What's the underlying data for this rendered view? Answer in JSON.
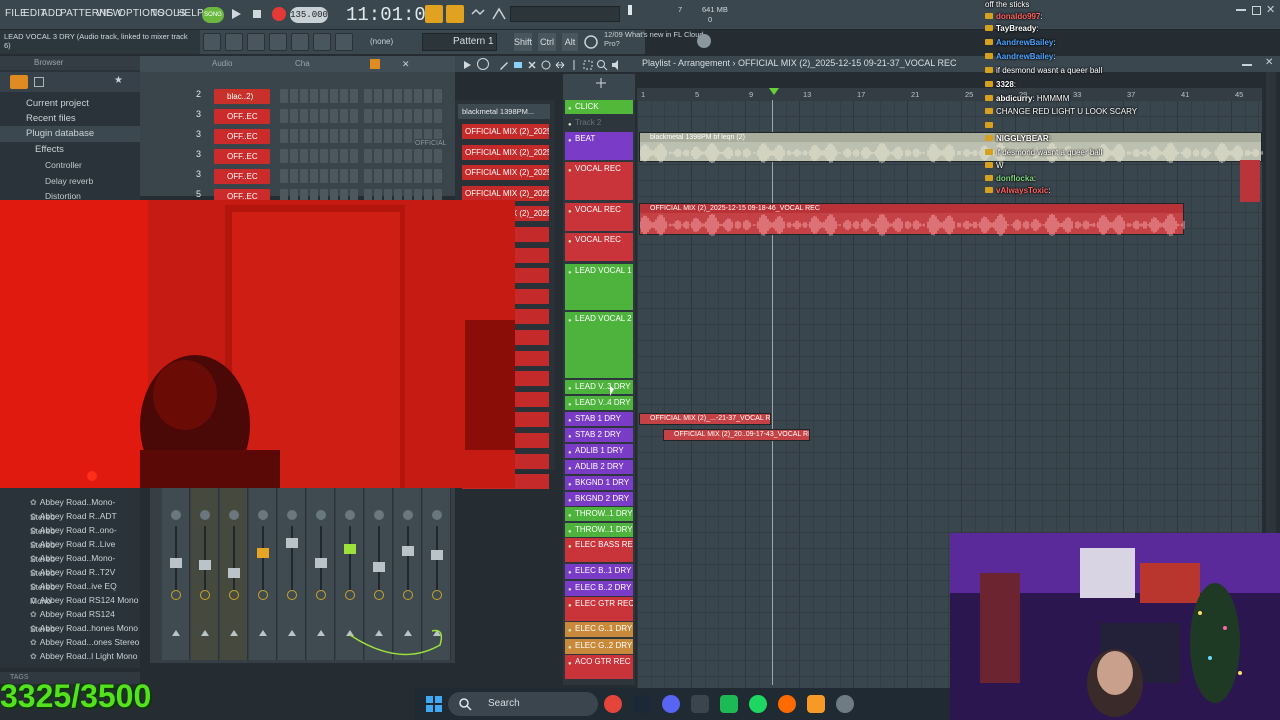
{
  "menu": [
    "FILE",
    "EDIT",
    "ADD",
    "PATTERNS",
    "VIEW",
    "OPTIONS",
    "TOOLS",
    "HELP"
  ],
  "song_mode": "SONG",
  "tempo": "135.000",
  "time": "11:01:01",
  "cpu": {
    "value": "7",
    "memory": "641 MB",
    "poly": "0"
  },
  "hint": "LEAD VOCAL 3 DRY (Audio track, linked to mixer track 6)",
  "snap": "(none)",
  "pattern": "Pattern 1",
  "mods": [
    "Shift",
    "Ctrl",
    "Alt"
  ],
  "news": {
    "date": "12/09",
    "text": "What's new in FL Cloud Pro?"
  },
  "browser": {
    "title": "Browser",
    "sections": [
      "Current project",
      "Recent files",
      "Plugin database",
      "Effects"
    ],
    "effects": [
      "Controller",
      "Delay reverb",
      "Distortion"
    ],
    "plugins": [
      "Abbey Road..Mono-Stereo",
      "Abbey Road R..ADT Stereo",
      "Abbey Road R..ono-Stereo",
      "Abbey Road R..Live Stereo",
      "Abbey Road..Mono-Stereo",
      "Abbey Road R..T2V Stereo",
      "Abbey Road..ive EQ Mono",
      "Abbey Road RS124 Mono",
      "Abbey Road RS124 Stereo",
      "Abbey Road..hones Mono",
      "Abbey Road...ones Stereo",
      "Abbey Road..l Light Mono"
    ],
    "tags_label": "TAGS"
  },
  "rack": {
    "header_left": "Audio",
    "header_right": "Cha",
    "rows": [
      {
        "num": "2",
        "name": "blac..2)"
      },
      {
        "num": "3",
        "name": "OFF..EC"
      },
      {
        "num": "3",
        "name": "OFF..EC"
      },
      {
        "num": "3",
        "name": "OFF..EC"
      },
      {
        "num": "3",
        "name": "OFF..EC"
      },
      {
        "num": "5",
        "name": "OFF..EC"
      }
    ],
    "official_tag": "OFFICIAL"
  },
  "patterns": {
    "header": "blackmetal 1398PM...",
    "items": [
      "OFFICIAL MIX (2)_2025-1..",
      "OFFICIAL MIX (2)_2025-1..",
      "OFFICIAL MIX (2)_2025-1..",
      "OFFICIAL MIX (2)_2025-1..",
      "OFFICIAL MIX (2)_2025-1..",
      "_2025-1..",
      "_2025-1..",
      "_2025-1..",
      "_2025-1..",
      "_2025-1..",
      "_2025-1..",
      "_2025-1..",
      "_2025-1..",
      "_2025-1..",
      "_2025-1..",
      "_2025-1..",
      "_2025-1..",
      "_2025-1.."
    ]
  },
  "playlist": {
    "title": "Playlist - Arrangement › OFFICIAL MIX (2)_2025-12-15 09-21-37_VOCAL REC",
    "ruler": [
      "1",
      "5",
      "9",
      "13",
      "17",
      "21",
      "25",
      "29",
      "33",
      "37",
      "41",
      "45"
    ],
    "tracks": [
      {
        "name": "CLICK",
        "color": "#52b83a"
      },
      {
        "name": "Track 2",
        "color": "#2d363c"
      },
      {
        "name": "BEAT",
        "color": "#7a3cc6"
      },
      {
        "name": "VOCAL REC",
        "color": "#c8343a"
      },
      {
        "name": "VOCAL REC",
        "color": "#c8343a"
      },
      {
        "name": "VOCAL REC",
        "color": "#c8343a"
      },
      {
        "name": "LEAD VOCAL 1 DRY",
        "color": "#4db33c"
      },
      {
        "name": "LEAD VOCAL 2 DRY",
        "color": "#4db33c"
      },
      {
        "name": "LEAD V..3 DRY",
        "color": "#4db33c"
      },
      {
        "name": "LEAD V..4 DRY",
        "color": "#4db33c"
      },
      {
        "name": "STAB 1 DRY",
        "color": "#7a3cc6"
      },
      {
        "name": "STAB 2 DRY",
        "color": "#7a3cc6"
      },
      {
        "name": "ADLIB 1 DRY",
        "color": "#7a3cc6"
      },
      {
        "name": "ADLIB 2 DRY",
        "color": "#7a3cc6"
      },
      {
        "name": "BKGND 1 DRY",
        "color": "#7a3cc6"
      },
      {
        "name": "BKGND 2 DRY",
        "color": "#7a3cc6"
      },
      {
        "name": "THROW..1 DRY",
        "color": "#4db33c"
      },
      {
        "name": "THROW..1 DRY",
        "color": "#4db33c"
      },
      {
        "name": "ELEC BASS REC",
        "color": "#c8343a"
      },
      {
        "name": "ELEC B..1 DRY",
        "color": "#7a3cc6"
      },
      {
        "name": "ELEC B..2 DRY",
        "color": "#7a3cc6"
      },
      {
        "name": "ELEC GTR REC",
        "color": "#c8343a"
      },
      {
        "name": "ELEC G..1 DRY",
        "color": "#c88a3a"
      },
      {
        "name": "ELEC G..2 DRY",
        "color": "#c88a3a"
      },
      {
        "name": "ACO GTR REC",
        "color": "#c8343a"
      }
    ],
    "clips": [
      {
        "label": "blackmetal 1398PM bf leqn (2)",
        "color": "#bcc0b0"
      },
      {
        "label": "OFFICIAL MIX (2)_2025-12-15 09-18-46_VOCAL REC",
        "color": "#c44245"
      },
      {
        "label": "OFFICIAL MIX (2)_...-21-37_VOCAL REC",
        "color": "#c44245"
      },
      {
        "label": "OFFICIAL MIX (2)_20..09-17-43_VOCAL REC",
        "color": "#c44245"
      }
    ]
  },
  "chat": [
    {
      "user": "",
      "msg": "off the sticks",
      "color": "#ffffff"
    },
    {
      "user": "donaldo997",
      "msg": "",
      "color": "#ff6060"
    },
    {
      "user": "TayBready",
      "msg": "",
      "color": "#ffffff"
    },
    {
      "user": "AandrewBailey",
      "msg": "",
      "color": "#4da3ff"
    },
    {
      "user": "AandrewBailey",
      "msg": "",
      "color": "#4da3ff"
    },
    {
      "user": "",
      "msg": "if desmond wasnt a queer ball",
      "color": "#ff6060"
    },
    {
      "user": "3328",
      "msg": "",
      "color": "#ffffff"
    },
    {
      "user": "abdicurry",
      "msg": "HMMMM",
      "color": "#ffffff"
    },
    {
      "user": "",
      "msg": "CHANGE RED LIGHT U LOOK SCARY",
      "color": "#ff6060"
    },
    {
      "user": "",
      "msg": "",
      "color": "#c77dff"
    },
    {
      "user": "NIGGLYBEAR",
      "msg": "",
      "color": "#ffffff"
    },
    {
      "user": "",
      "msg": "if desmond wasnt a queer ball",
      "color": "#ff6060"
    },
    {
      "user": "",
      "msg": "W",
      "color": "#ff6060"
    },
    {
      "user": "donflocka",
      "msg": "",
      "color": "#7fd67f"
    },
    {
      "user": "vAlwaysToxic",
      "msg": "",
      "color": "#ff6060"
    }
  ],
  "taskbar": {
    "search": "Search"
  },
  "counter": "3325/3500",
  "colors": {
    "accent_red": "#c8343a",
    "accent_green": "#4db33c",
    "bg": "#252d33",
    "counter_green": "#54e21f"
  }
}
